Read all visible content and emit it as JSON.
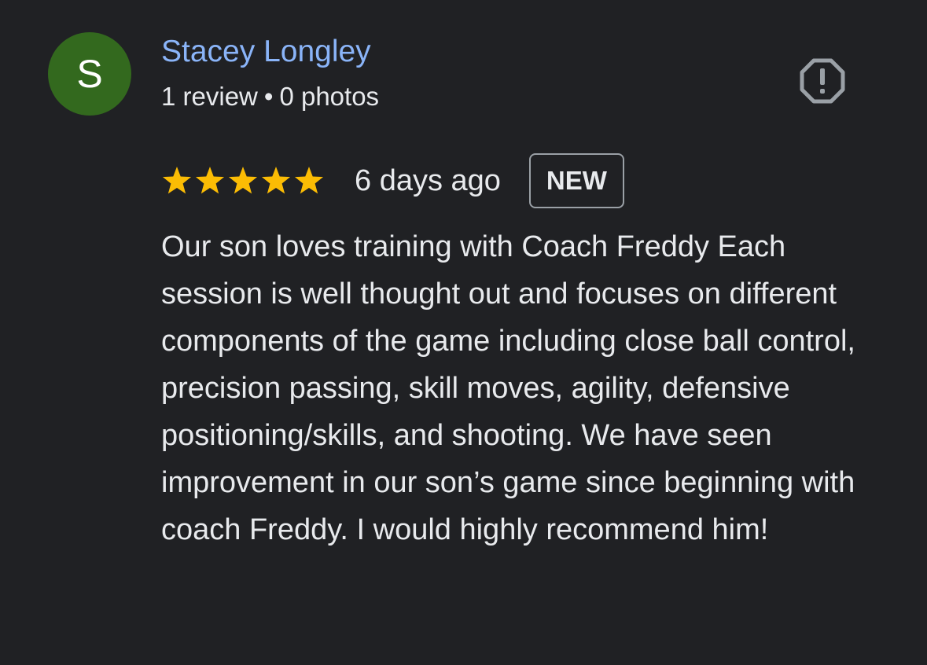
{
  "review": {
    "author": {
      "initial": "S",
      "name": "Stacey Longley",
      "review_count": "1 review",
      "separator": "•",
      "photo_count": "0 photos",
      "avatar_color": "#33691e",
      "name_color": "#8ab4f8"
    },
    "report_icon": "report-flag-icon",
    "rating": {
      "stars": 5,
      "max_stars": 5,
      "star_color": "#fbbc04",
      "star_icon": "star-icon"
    },
    "date": "6 days ago",
    "badge": "NEW",
    "text": "Our son loves training with Coach Freddy Each session is well thought out and focuses on different components of the game including close ball control, precision passing, skill moves, agility, defensive positioning/skills, and shooting. We have seen improvement in our son’s game since beginning with coach Freddy. I would highly recommend him!"
  },
  "theme": {
    "background": "#202124",
    "text": "#e8eaed",
    "badge_border": "#9aa0a6"
  }
}
